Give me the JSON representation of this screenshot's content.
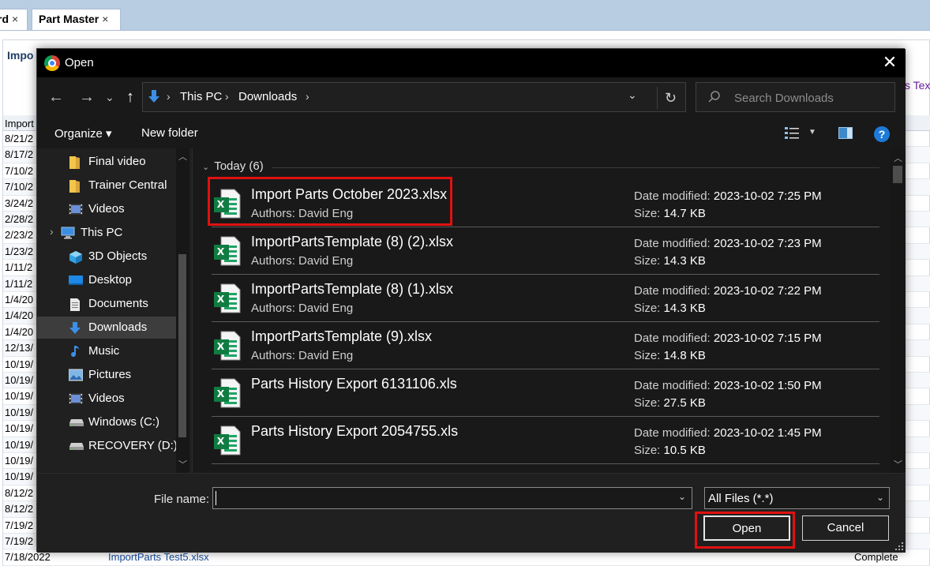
{
  "app": {
    "tabs": [
      {
        "label": "rd",
        "close": "×"
      },
      {
        "label": "Part Master",
        "close": "×"
      }
    ],
    "heading": "Impo",
    "right_link": "s Tex",
    "grid_header": "Import",
    "rows": [
      {
        "date": "8/21/2"
      },
      {
        "date": "8/17/2"
      },
      {
        "date": "7/10/2"
      },
      {
        "date": "7/10/2"
      },
      {
        "date": "3/24/2"
      },
      {
        "date": "2/28/2"
      },
      {
        "date": "2/23/2"
      },
      {
        "date": "1/23/2"
      },
      {
        "date": "1/11/2"
      },
      {
        "date": "1/11/2"
      },
      {
        "date": "1/4/20"
      },
      {
        "date": "1/4/20"
      },
      {
        "date": "1/4/20"
      },
      {
        "date": "12/13/"
      },
      {
        "date": "10/19/"
      },
      {
        "date": "10/19/"
      },
      {
        "date": "10/19/"
      },
      {
        "date": "10/19/"
      },
      {
        "date": "10/19/"
      },
      {
        "date": "10/19/"
      },
      {
        "date": "10/19/"
      },
      {
        "date": "10/19/"
      },
      {
        "date": "8/12/2"
      },
      {
        "date": "8/12/2"
      },
      {
        "date": "7/19/2"
      },
      {
        "date": "7/19/2"
      },
      {
        "date": "7/18/2022",
        "file": "ImportParts Test5.xlsx",
        "status": "Complete"
      }
    ]
  },
  "dialog": {
    "title": "Open",
    "close": "✕",
    "nav": {
      "back": "←",
      "forward": "→",
      "recent": "⌄",
      "up": "↑",
      "breadcrumb": [
        "This PC",
        "Downloads"
      ],
      "search_placeholder": "Search Downloads"
    },
    "toolbar": {
      "organize": "Organize ▾",
      "new_folder": "New folder",
      "help": "?"
    },
    "sidebar": [
      {
        "label": "Final video",
        "icon": "folder-icon"
      },
      {
        "label": "Trainer Central",
        "icon": "folder-icon"
      },
      {
        "label": "Videos",
        "icon": "video-icon"
      },
      {
        "label": "This PC",
        "icon": "computer-icon"
      },
      {
        "label": "3D Objects",
        "icon": "cube-icon"
      },
      {
        "label": "Desktop",
        "icon": "desktop-icon"
      },
      {
        "label": "Documents",
        "icon": "document-icon"
      },
      {
        "label": "Downloads",
        "icon": "download-icon",
        "selected": true
      },
      {
        "label": "Music",
        "icon": "music-icon"
      },
      {
        "label": "Pictures",
        "icon": "picture-icon"
      },
      {
        "label": "Videos",
        "icon": "video-icon"
      },
      {
        "label": "Windows (C:)",
        "icon": "drive-icon"
      },
      {
        "label": "RECOVERY (D:)",
        "icon": "drive-icon"
      }
    ],
    "group_header": "Today (6)",
    "date_label": "Date modified:",
    "size_label": "Size:",
    "files": [
      {
        "name": "Import Parts October 2023.xlsx",
        "authors": "Authors: David Eng",
        "date": "2023-10-02 7:25 PM",
        "size": "14.7 KB",
        "highlighted": true
      },
      {
        "name": "ImportPartsTemplate (8) (2).xlsx",
        "authors": "Authors: David Eng",
        "date": "2023-10-02 7:23 PM",
        "size": "14.3 KB"
      },
      {
        "name": "ImportPartsTemplate (8) (1).xlsx",
        "authors": "Authors: David Eng",
        "date": "2023-10-02 7:22 PM",
        "size": "14.3 KB"
      },
      {
        "name": "ImportPartsTemplate (9).xlsx",
        "authors": "Authors: David Eng",
        "date": "2023-10-02 7:15 PM",
        "size": "14.8 KB"
      },
      {
        "name": "Parts History Export 6131106.xls",
        "authors": "",
        "date": "2023-10-02 1:50 PM",
        "size": "27.5 KB"
      },
      {
        "name": "Parts History Export 2054755.xls",
        "authors": "",
        "date": "2023-10-02 1:45 PM",
        "size": "10.5 KB"
      }
    ],
    "file_name_label": "File name:",
    "file_name_value": "",
    "file_type": "All Files (*.*)",
    "open_label": "Open",
    "cancel_label": "Cancel",
    "highlight_color": "#e01111"
  }
}
